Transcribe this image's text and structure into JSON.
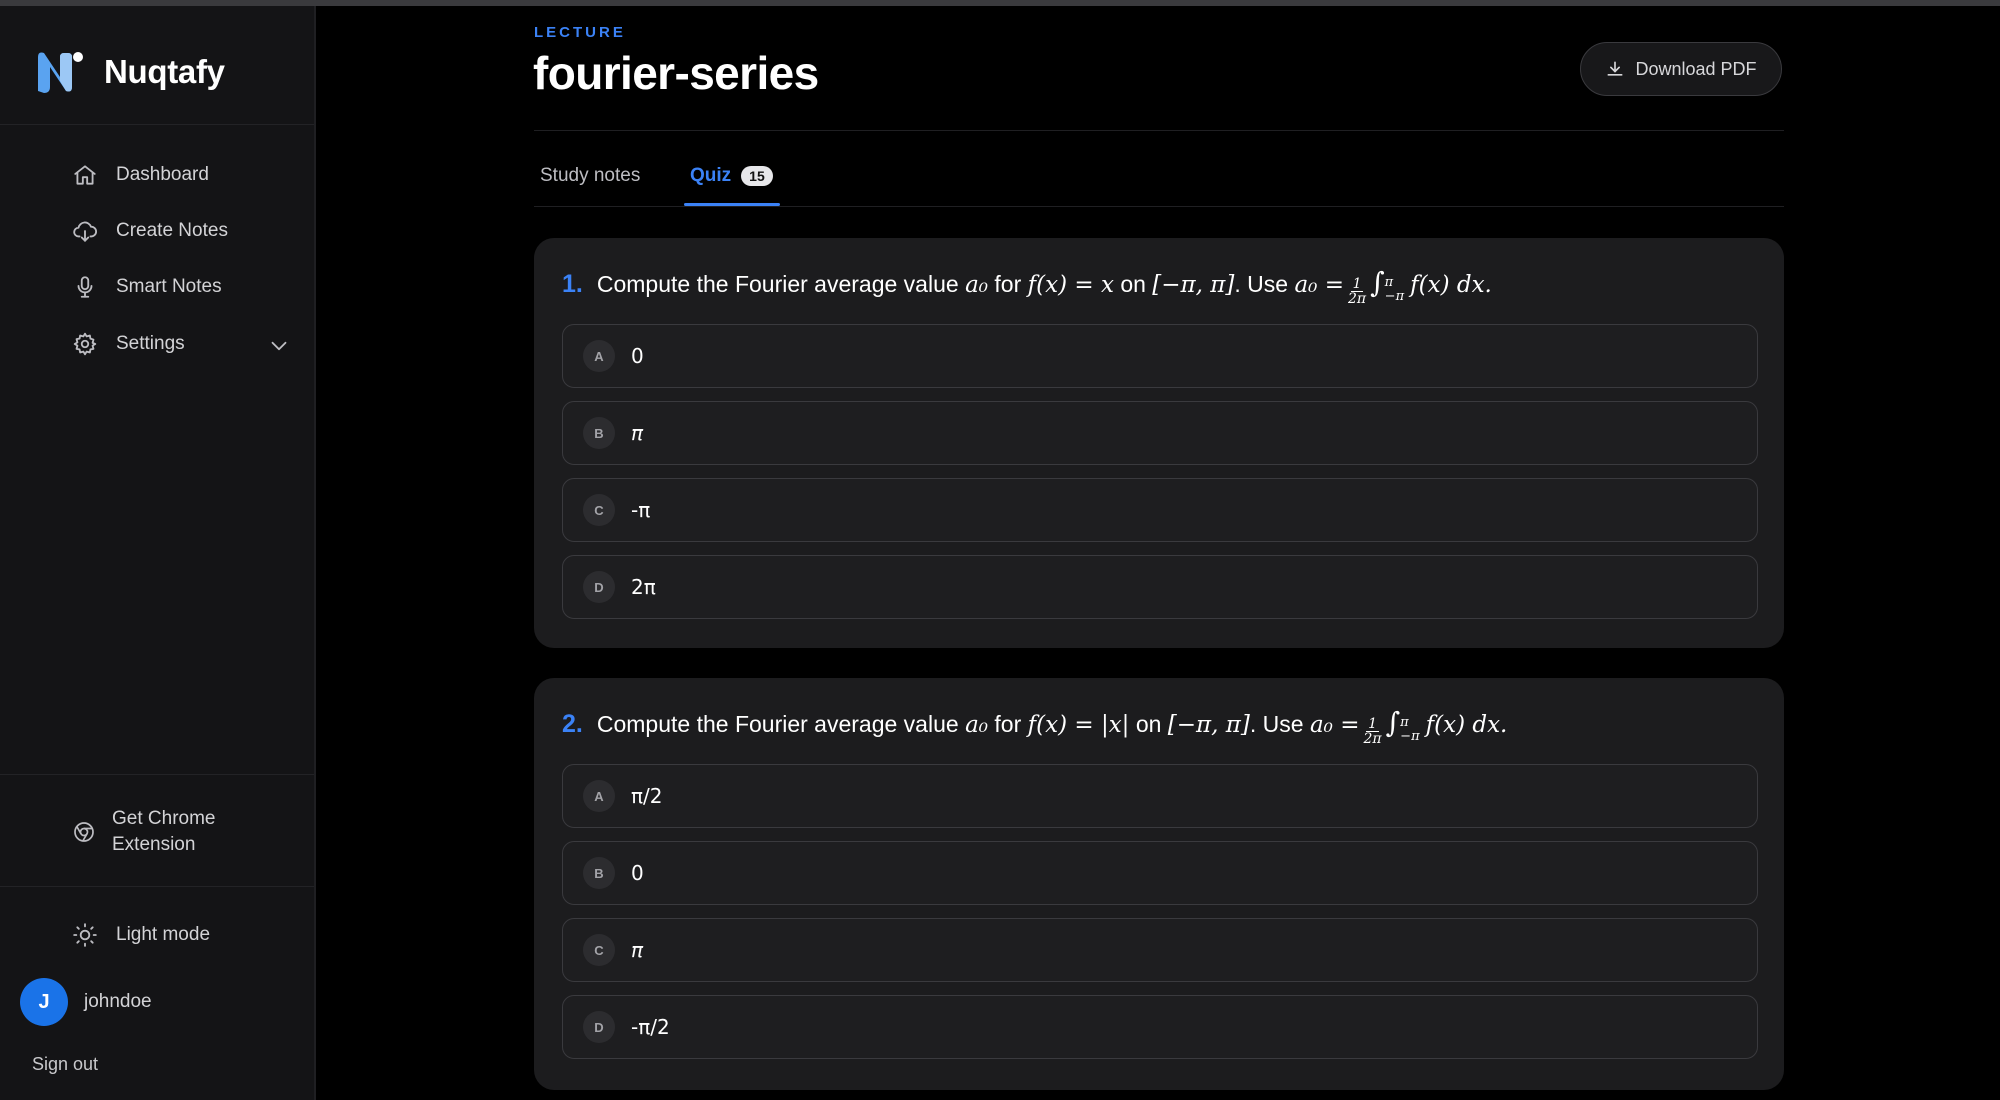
{
  "brand": {
    "name": "Nuqtafy"
  },
  "sidebar": {
    "items": [
      {
        "label": "Dashboard",
        "icon": "home-icon"
      },
      {
        "label": "Create Notes",
        "icon": "cloud-upload-icon"
      },
      {
        "label": "Smart Notes",
        "icon": "microphone-icon"
      },
      {
        "label": "Settings",
        "icon": "gear-icon"
      }
    ],
    "chrome_ext": "Get Chrome Extension",
    "theme_toggle": "Light mode",
    "user": {
      "initial": "J",
      "name": "johndoe"
    },
    "sign_out": "Sign out"
  },
  "header": {
    "eyebrow": "LECTURE",
    "title": "fourier-series",
    "download": "Download PDF"
  },
  "tabs": [
    {
      "label": "Study notes",
      "active": false
    },
    {
      "label": "Quiz",
      "active": true,
      "count": "15"
    }
  ],
  "quiz": [
    {
      "num": "1.",
      "text_pre": "Compute the Fourier average value",
      "a0": "a₀",
      "for": "for",
      "fx": "f(x) = x",
      "on": "on",
      "interval": "[−π, π]",
      "use": ". Use",
      "formula_lhs": "a₀ =",
      "frac_n": "1",
      "frac_d": "2π",
      "integral": "∫",
      "sup": "π",
      "sub": "−π",
      "integrand": "f(x) dx.",
      "options": [
        {
          "letter": "A",
          "text": "0"
        },
        {
          "letter": "B",
          "text": "π"
        },
        {
          "letter": "C",
          "text": "-π"
        },
        {
          "letter": "D",
          "text": "2π"
        }
      ]
    },
    {
      "num": "2.",
      "text_pre": "Compute the Fourier average value",
      "a0": "a₀",
      "for": "for",
      "fx": "f(x) = |x|",
      "on": "on",
      "interval": "[−π, π]",
      "use": ". Use",
      "formula_lhs": "a₀ =",
      "frac_n": "1",
      "frac_d": "2π",
      "integral": "∫",
      "sup": "π",
      "sub": "−π",
      "integrand": "f(x) dx.",
      "options": [
        {
          "letter": "A",
          "text": "π/2"
        },
        {
          "letter": "B",
          "text": "0"
        },
        {
          "letter": "C",
          "text": "π"
        },
        {
          "letter": "D",
          "text": "-π/2"
        }
      ]
    }
  ],
  "colors": {
    "accent": "#3b82f6",
    "sidebar": "#141416",
    "card": "#1c1c1e"
  }
}
